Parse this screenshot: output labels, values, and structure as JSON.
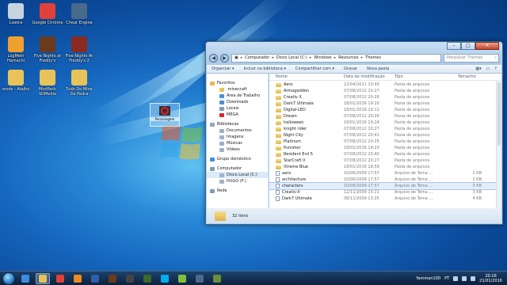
{
  "desktop": {
    "icons": [
      {
        "label": "Lixeira",
        "icon": "recycle-bin-icon",
        "color": "#c7d3de"
      },
      {
        "label": "Google Chrome",
        "icon": "chrome-icon",
        "color": "#e0413a"
      },
      {
        "label": "Cheat Engine",
        "icon": "cheat-engine-icon",
        "color": "#4a6a8c"
      },
      {
        "label": "LogMeIn Hamachi",
        "icon": "hamachi-icon",
        "color": "#f0a030"
      },
      {
        "label": "Five Nights at Freddy's",
        "icon": "fnaf-icon",
        "color": "#6b3a1a"
      },
      {
        "label": "Five Nights At Freddy's 2",
        "icon": "fnaf2-icon",
        "color": "#8a2a20"
      },
      {
        "label": "mods - Atalho",
        "icon": "folder-shortcut-icon",
        "color": "#e8c35a"
      },
      {
        "label": "ModPack SDMedia",
        "icon": "folder-shortcut-icon",
        "color": "#e8c35a"
      },
      {
        "label": "Tudo Do Mine De Pedra",
        "icon": "folder-shortcut-icon",
        "color": "#e8c35a"
      }
    ],
    "dragged_icon_label": "Personagem",
    "dragged_icon": "red-ring-icon"
  },
  "window": {
    "controls": {
      "minimize": "–",
      "maximize": "□",
      "close": "✕"
    },
    "nav": {
      "back": "◀",
      "forward": "▶"
    },
    "breadcrumb": [
      "Computador",
      "Disco Local (C:)",
      "Windows",
      "Resources",
      "Themes"
    ],
    "search_placeholder": "Pesquisar Themes",
    "toolbar": {
      "organize": "Organizar ▾",
      "include": "Incluir na biblioteca ▾",
      "share": "Compartilhar com ▾",
      "burn": "Gravar",
      "new_folder": "Nova pasta"
    },
    "nav_pane": [
      {
        "label": "Favoritos",
        "type": "hdr",
        "icon": "star-icon",
        "color": "#e8b84a"
      },
      {
        "label": ".minecraft",
        "type": "sub",
        "icon": "folder-icon",
        "color": "#e8c35a"
      },
      {
        "label": "Área de Trabalho",
        "type": "sub",
        "icon": "desktop-icon",
        "color": "#4d8fd6"
      },
      {
        "label": "Downloads",
        "type": "sub",
        "icon": "downloads-icon",
        "color": "#4d8fd6"
      },
      {
        "label": "Locais",
        "type": "sub",
        "icon": "places-icon",
        "color": "#7f9bbb"
      },
      {
        "label": "MEGA",
        "type": "sub",
        "icon": "mega-icon",
        "color": "#d9272e"
      },
      {
        "label": "Bibliotecas",
        "type": "hdr",
        "icon": "library-icon",
        "color": "#8fa8c4"
      },
      {
        "label": "Documentos",
        "type": "sub",
        "icon": "documents-icon",
        "color": "#9bb2cb"
      },
      {
        "label": "Imagens",
        "type": "sub",
        "icon": "pictures-icon",
        "color": "#9bb2cb"
      },
      {
        "label": "Músicas",
        "type": "sub",
        "icon": "music-icon",
        "color": "#9bb2cb"
      },
      {
        "label": "Vídeos",
        "type": "sub",
        "icon": "videos-icon",
        "color": "#9bb2cb"
      },
      {
        "label": "Grupo doméstico",
        "type": "hdr",
        "icon": "homegroup-icon",
        "color": "#3f8fd6"
      },
      {
        "label": "Computador",
        "type": "hdr",
        "icon": "computer-icon",
        "color": "#7f9bbb"
      },
      {
        "label": "Disco Local (C:)",
        "type": "sub",
        "icon": "drive-icon",
        "color": "#9fb3c8",
        "selected": true
      },
      {
        "label": "HUGO (F:)",
        "type": "sub",
        "icon": "usb-drive-icon",
        "color": "#9fb3c8"
      },
      {
        "label": "Rede",
        "type": "hdr",
        "icon": "network-icon",
        "color": "#7f9bbb"
      }
    ],
    "columns": {
      "name": "Nome",
      "date": "Data de modificação",
      "type": "Tipo",
      "size": "Tamanho"
    },
    "files": [
      {
        "name": "Aero",
        "date": "12/04/2011 10:40",
        "type": "Pasta de arquivos",
        "size": "",
        "kind": "folder"
      },
      {
        "name": "Armageddon",
        "date": "07/08/2012 20:27",
        "type": "Pasta de arquivos",
        "size": "",
        "kind": "folder"
      },
      {
        "name": "Creativ X",
        "date": "07/08/2012 20:26",
        "type": "Pasta de arquivos",
        "size": "",
        "kind": "folder"
      },
      {
        "name": "Dark7 Ultimate",
        "date": "18/01/2016 19:20",
        "type": "Pasta de arquivos",
        "size": "",
        "kind": "folder"
      },
      {
        "name": "Digital-LED",
        "date": "18/01/2016 19:11",
        "type": "Pasta de arquivos",
        "size": "",
        "kind": "folder"
      },
      {
        "name": "Dream",
        "date": "07/08/2012 20:26",
        "type": "Pasta de arquivos",
        "size": "",
        "kind": "folder"
      },
      {
        "name": "halloween",
        "date": "18/01/2016 19:24",
        "type": "Pasta de arquivos",
        "size": "",
        "kind": "folder"
      },
      {
        "name": "knight rider",
        "date": "07/08/2012 20:27",
        "type": "Pasta de arquivos",
        "size": "",
        "kind": "folder"
      },
      {
        "name": "Night City",
        "date": "07/08/2012 20:41",
        "type": "Pasta de arquivos",
        "size": "",
        "kind": "folder"
      },
      {
        "name": "Platinum",
        "date": "07/08/2012 20:25",
        "type": "Pasta de arquivos",
        "size": "",
        "kind": "folder"
      },
      {
        "name": "Punisher",
        "date": "18/01/2016 19:23",
        "type": "Pasta de arquivos",
        "size": "",
        "kind": "folder"
      },
      {
        "name": "Resident Evil 5",
        "date": "07/08/2012 20:40",
        "type": "Pasta de arquivos",
        "size": "",
        "kind": "folder"
      },
      {
        "name": "StarCraft II",
        "date": "07/08/2012 20:27",
        "type": "Pasta de arquivos",
        "size": "",
        "kind": "folder"
      },
      {
        "name": "Xtreme Blue",
        "date": "18/01/2016 18:59",
        "type": "Pasta de arquivos",
        "size": "",
        "kind": "folder"
      },
      {
        "name": "aero",
        "date": "10/06/2009 17:57",
        "type": "Arquivo de Tema ...",
        "size": "2 KB",
        "kind": "file"
      },
      {
        "name": "architecture",
        "date": "10/06/2009 17:57",
        "type": "Arquivo de Tema ...",
        "size": "2 KB",
        "kind": "file"
      },
      {
        "name": "characters",
        "date": "10/06/2009 17:57",
        "type": "Arquivo de Tema ...",
        "size": "3 KB",
        "kind": "file",
        "selected": true
      },
      {
        "name": "Creativ-X",
        "date": "12/11/2009 15:21",
        "type": "Arquivo de Tema ...",
        "size": "3 KB",
        "kind": "file"
      },
      {
        "name": "Dark7 Ultimate",
        "date": "08/11/2009 13:25",
        "type": "Arquivo de Tema ...",
        "size": "4 KB",
        "kind": "file"
      }
    ],
    "status_text": "32 itens"
  },
  "taskbar": {
    "buttons": [
      {
        "icon": "ie-icon",
        "color": "#3a8ee0"
      },
      {
        "icon": "explorer-icon",
        "color": "#e8c35a",
        "active": true
      },
      {
        "icon": "chrome-icon",
        "color": "#e0413a"
      },
      {
        "icon": "media-player-icon",
        "color": "#f08a24"
      },
      {
        "icon": "word-icon",
        "color": "#2f5fa8"
      },
      {
        "icon": "fnaf-icon",
        "color": "#6b3a1a"
      },
      {
        "icon": "film-icon",
        "color": "#444444"
      },
      {
        "icon": "game-icon",
        "color": "#3a6a2a"
      },
      {
        "icon": "skype-icon",
        "color": "#00aff0"
      },
      {
        "icon": "torrent-icon",
        "color": "#7fbf3f"
      },
      {
        "icon": "cheat-engine-icon",
        "color": "#4a6a8c"
      },
      {
        "icon": "minecraft-icon",
        "color": "#6a8f3a"
      }
    ],
    "tray_user": "Yamman100",
    "tray_lang": "PT",
    "time": "20:16",
    "date": "21/01/2016"
  },
  "colors": {
    "accent": "#1566bd",
    "selection": "#dcebfa"
  }
}
